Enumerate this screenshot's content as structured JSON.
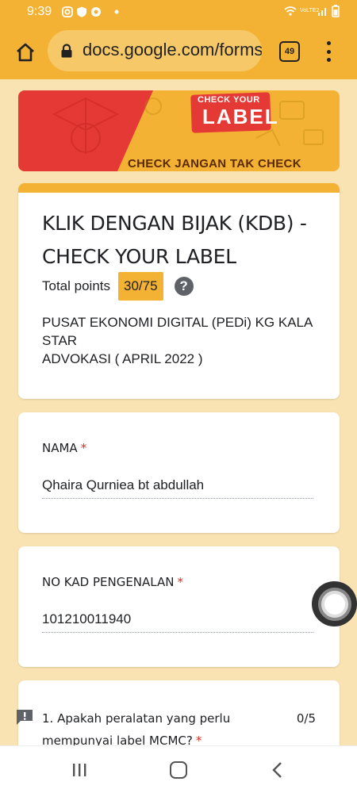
{
  "status_bar": {
    "time": "9:39",
    "signal_label": "VoLTE2"
  },
  "browser": {
    "url": "docs.google.com/forms",
    "tab_count": "49"
  },
  "banner": {
    "badge_top": "CHECK YOUR",
    "badge_main": "LABEL",
    "tagline": "CHECK JANGAN TAK CHECK"
  },
  "form": {
    "title": "KLIK DENGAN BIJAK (KDB) - CHECK YOUR LABEL",
    "points_label": "Total points",
    "points_value": "30/75",
    "description_line1": "PUSAT EKONOMI DIGITAL (PEDi) KG KALA STAR",
    "description_line2": "ADVOKASI ( APRIL 2022 )"
  },
  "questions": [
    {
      "label": "NAMA",
      "required_mark": "*",
      "answer": "Qhaira Qurniea bt abdullah"
    },
    {
      "label": "NO KAD PENGENALAN",
      "required_mark": "*",
      "answer": "101210011940"
    },
    {
      "label": "1. Apakah peralatan yang perlu mempunyai label MCMC?",
      "required_mark": "*",
      "score": "0/5"
    }
  ],
  "colors": {
    "theme": "#f3b234",
    "background": "#f9e3b3",
    "required": "#d93025",
    "banner_red": "#e53935"
  }
}
